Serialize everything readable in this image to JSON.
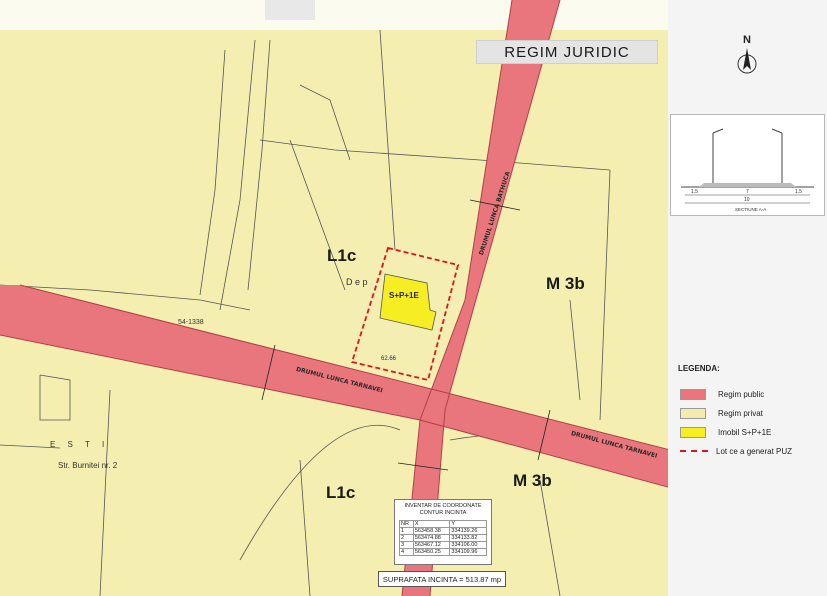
{
  "title": "REGIM  JURIDIC",
  "compass": {
    "label": "N"
  },
  "zones": [
    "L1c",
    "M 3b",
    "L1c",
    "M 3b"
  ],
  "building_label": "S+P+1E",
  "lot_area_label": "62.66",
  "street_labels": {
    "drumul_lunca_tarnavei": "DRUMUL LUNCA TARNAVEI",
    "drumul_lunca_tarnavei_2": "DRUMUL LUNCA TARNAVEI",
    "drumul_lunca_bathuca": "DRUMUL LUNCA BATHUCA",
    "str_burnitei": "Str. Burnitei  nr. 2",
    "esti": "E S T I",
    "dep": "D e p",
    "parcel_id": "54-1338"
  },
  "section": {
    "caption": "SECTIUNE A-A",
    "dims": [
      "1.5",
      "7",
      "1.5",
      "10"
    ]
  },
  "legend": {
    "title": "LEGENDA:",
    "items": [
      {
        "label": "Regim public",
        "color": "#e8767c"
      },
      {
        "label": "Regim privat",
        "color": "#f3ecae"
      },
      {
        "label": "Imobil S+P+1E",
        "color": "#f6ee22"
      },
      {
        "label": "Lot ce a generat PUZ",
        "color": "#e0141e"
      }
    ]
  },
  "inventory": {
    "title_line1": "INVENTAR DE COORDONATE",
    "title_line2": "CONTUR INCINTA",
    "headers": [
      "NR",
      "X",
      "Y"
    ],
    "rows": [
      [
        "1",
        "563458.38",
        "334139.26"
      ],
      [
        "2",
        "563474.88",
        "334133.82"
      ],
      [
        "3",
        "563467.12",
        "334106.00"
      ],
      [
        "4",
        "563450.25",
        "334109.96"
      ]
    ]
  },
  "area": "SUPRAFATA INCINTA = 513.87 mp",
  "colors": {
    "public": "#e8767c",
    "private": "#f3ecae",
    "building": "#f6ee22",
    "lot": "#e0141e"
  }
}
